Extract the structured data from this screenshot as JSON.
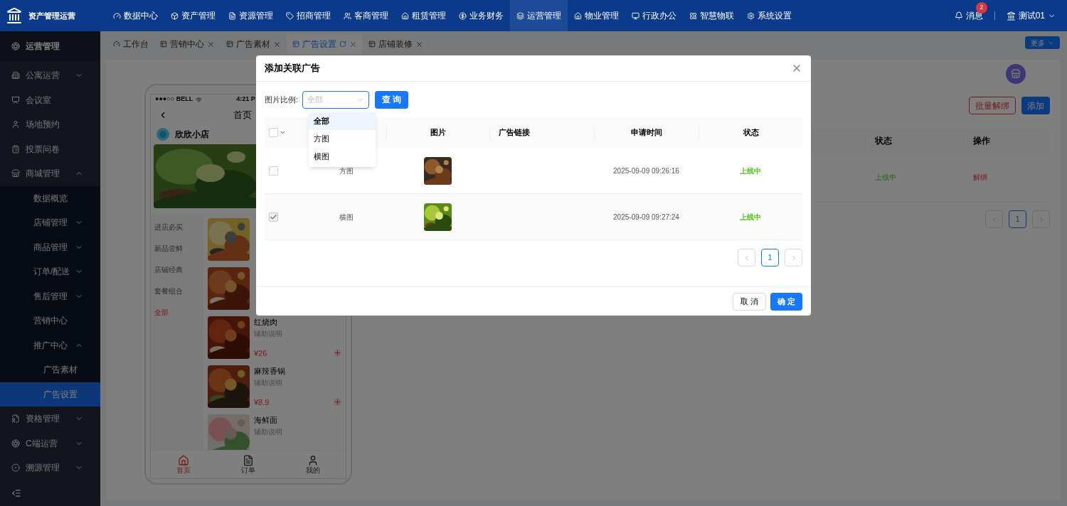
{
  "header": {
    "app_title": "资产管理运营",
    "nav": [
      {
        "label": "数据中心",
        "selected": false
      },
      {
        "label": "资产管理",
        "selected": false
      },
      {
        "label": "资源管理",
        "selected": false
      },
      {
        "label": "招商管理",
        "selected": false
      },
      {
        "label": "客商管理",
        "selected": false
      },
      {
        "label": "租赁管理",
        "selected": false
      },
      {
        "label": "业务财务",
        "selected": false
      },
      {
        "label": "运营管理",
        "selected": true
      },
      {
        "label": "物业管理",
        "selected": false
      },
      {
        "label": "行政办公",
        "selected": false
      },
      {
        "label": "智慧物联",
        "selected": false
      },
      {
        "label": "系统设置",
        "selected": false
      }
    ],
    "messages": {
      "label": "消息",
      "badge": "2"
    },
    "user": "测试01"
  },
  "sidebar": {
    "title": "运营管理",
    "items": [
      {
        "label": "公寓运营",
        "has_children": true,
        "expanded": false,
        "selected": false
      },
      {
        "label": "会议室",
        "has_children": false,
        "selected": false
      },
      {
        "label": "场地预约",
        "has_children": false,
        "selected": false
      },
      {
        "label": "投票问卷",
        "has_children": false,
        "selected": false
      },
      {
        "label": "商城管理",
        "has_children": true,
        "expanded": true,
        "selected": false,
        "children": [
          {
            "label": "数据概览",
            "has_children": false,
            "selected": false
          },
          {
            "label": "店铺管理",
            "has_children": true,
            "expanded": false,
            "selected": false
          },
          {
            "label": "商品管理",
            "has_children": true,
            "expanded": false,
            "selected": false
          },
          {
            "label": "订单/配送",
            "has_children": true,
            "expanded": false,
            "selected": false
          },
          {
            "label": "售后管理",
            "has_children": true,
            "expanded": false,
            "selected": false
          },
          {
            "label": "营销中心",
            "has_children": false,
            "selected": false
          },
          {
            "label": "推广中心",
            "has_children": true,
            "expanded": true,
            "selected": false,
            "children": [
              {
                "label": "广告素材",
                "has_children": false,
                "selected": false
              },
              {
                "label": "广告设置",
                "has_children": false,
                "selected": true
              }
            ]
          }
        ]
      },
      {
        "label": "资格管理",
        "has_children": true,
        "expanded": false,
        "selected": false
      },
      {
        "label": "C端运营",
        "has_children": true,
        "expanded": false,
        "selected": false
      },
      {
        "label": "溯源管理",
        "has_children": true,
        "expanded": false,
        "selected": false
      }
    ]
  },
  "tabs": [
    {
      "label": "工作台",
      "selected": false,
      "closable": false
    },
    {
      "label": "营销中心",
      "selected": false,
      "closable": true
    },
    {
      "label": "广告素材",
      "selected": false,
      "closable": true
    },
    {
      "label": "广告设置",
      "selected": true,
      "closable": true
    },
    {
      "label": "店铺装修",
      "selected": false,
      "closable": true
    }
  ],
  "more_button": "更多",
  "phone": {
    "carrier": "●●●○○ BELL",
    "time": "4:21 P",
    "title": "首页",
    "store": "欣欣小店",
    "categories": [
      {
        "label": "进店必买",
        "selected": false
      },
      {
        "label": "新品尝鲜",
        "selected": false
      },
      {
        "label": "店铺经典",
        "selected": false
      },
      {
        "label": "套餐组合",
        "selected": false
      },
      {
        "label": "全部",
        "selected": true
      }
    ],
    "dishes": [
      {
        "kind": "picture"
      },
      {
        "kind": "picture"
      },
      {
        "kind": "dish",
        "name": "红烧肉",
        "desc": "辅助说明",
        "price": "¥26"
      },
      {
        "kind": "dish",
        "name": "麻辣香锅",
        "desc": "辅助说明",
        "price": "¥8.9"
      },
      {
        "kind": "dish",
        "name": "海鲜面",
        "desc": "辅助说明"
      }
    ],
    "tabbar": [
      {
        "label": "首页",
        "selected": true
      },
      {
        "label": "订单",
        "selected": false
      },
      {
        "label": "我的",
        "selected": false
      }
    ]
  },
  "page": {
    "buttons": [
      "批量解绑",
      "添加"
    ],
    "columns": [
      "状态",
      "操作"
    ],
    "rows": [
      [
        "上线中",
        "解绑"
      ]
    ],
    "pages": [
      {
        "label": "1",
        "selected": true
      }
    ]
  },
  "modal": {
    "title": "添加关联广告",
    "filter_label": "图片比例:",
    "select_placeholder": "全部",
    "query_button": "查 询",
    "options": [
      {
        "label": "全部",
        "selected": true
      },
      {
        "label": "方图",
        "selected": false
      },
      {
        "label": "横图",
        "selected": false
      }
    ],
    "select_all": {
      "checked": false
    },
    "columns": [
      "图片",
      "广告链接",
      "申请时间",
      "状态"
    ],
    "rows": [
      {
        "checked": false,
        "disabled": false,
        "ratio": "方图",
        "time": "2025-09-09 09:26:16",
        "status": "上线中"
      },
      {
        "checked": true,
        "disabled": true,
        "ratio": "横图",
        "time": "2025-09-09 09:27:24",
        "status": "上线中"
      }
    ],
    "pages": [
      {
        "label": "1",
        "selected": true
      }
    ],
    "cancel": "取 消",
    "confirm": "确 定"
  }
}
